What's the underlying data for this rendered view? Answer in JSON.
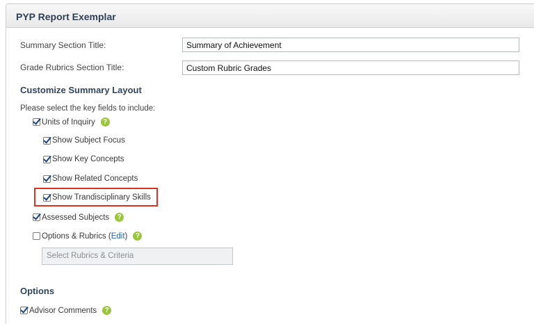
{
  "panel": {
    "title": "PYP Report Exemplar"
  },
  "summary_title": {
    "label": "Summary Section Title:",
    "value": "Summary of Achievement"
  },
  "grade_rubrics_title": {
    "label": "Grade Rubrics Section Title:",
    "value": "Custom Rubric Grades"
  },
  "customize": {
    "heading": "Customize Summary Layout",
    "instructions": "Please select the key fields to include:",
    "units_of_inquiry": "Units of Inquiry",
    "show_subject_focus": "Show Subject Focus",
    "show_key_concepts": "Show Key Concepts",
    "show_related_concepts": "Show Related Concepts",
    "show_transdisciplinary_skills": "Show Trandisciplinary Skills",
    "assessed_subjects": "Assessed Subjects",
    "options_rubrics": "Options & Rubrics (",
    "edit": "Edit",
    "close_paren": ")",
    "select_rubrics": "Select Rubrics & Criteria"
  },
  "options": {
    "heading": "Options",
    "advisor_comments": "Advisor Comments"
  },
  "help_glyph": "?",
  "icons": [
    "checkbox-checked-icon",
    "checkbox-unchecked-icon",
    "help-icon"
  ],
  "colors": {
    "help": "#9bc63b",
    "highlight": "#e03020",
    "link": "#1f63b4",
    "heading": "#2f4660"
  }
}
